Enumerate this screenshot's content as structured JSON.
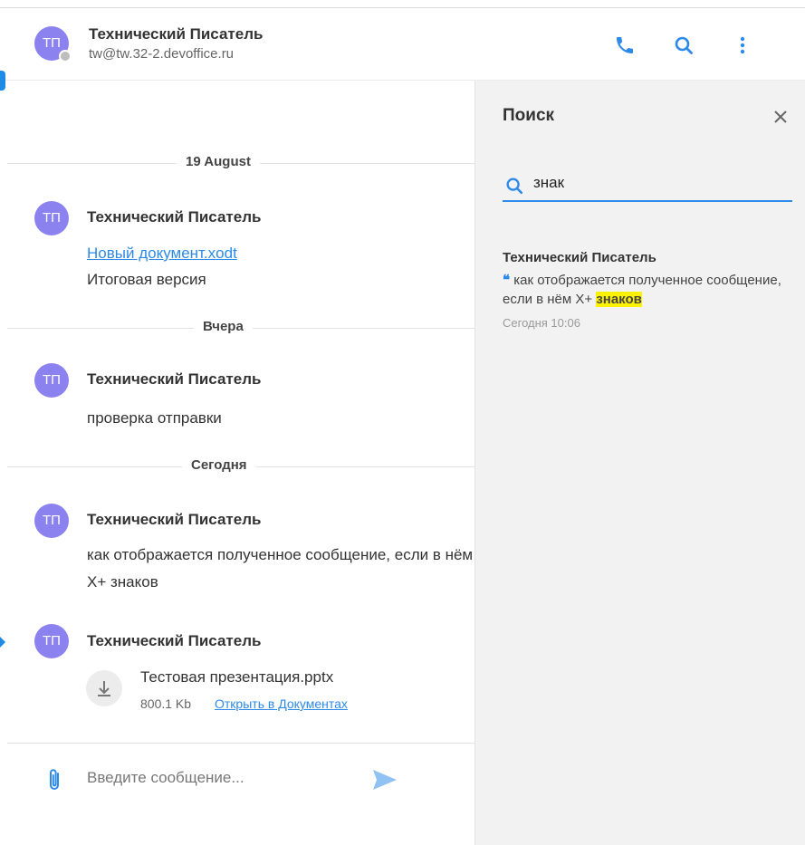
{
  "header": {
    "avatar_initials": "ТП",
    "contact_name": "Технический Писатель",
    "contact_email": "tw@tw.32-2.devoffice.ru",
    "icons": [
      "phone-icon",
      "search-icon",
      "more-vertical-icon"
    ]
  },
  "chat": {
    "days": [
      "19 August",
      "Вчера",
      "Сегодня"
    ],
    "messages": [
      {
        "avatar": "ТП",
        "author": "Технический Писатель",
        "link": "Новый документ.xodt",
        "text": "Итоговая версия"
      },
      {
        "avatar": "ТП",
        "author": "Технический Писатель",
        "text": "проверка отправки"
      },
      {
        "avatar": "ТП",
        "author": "Технический Писатель",
        "text_line1": "как отображается полученное сообщение, если в нём",
        "text_line2": "X+ знаков"
      },
      {
        "avatar": "ТП",
        "author": "Технический Писатель",
        "file_name": "Тестовая презентация.pptx",
        "file_size": "800.1 Kb",
        "file_open": "Открыть в Документах"
      }
    ]
  },
  "composer": {
    "placeholder": "Введите сообщение...",
    "icons": [
      "paperclip-icon",
      "send-icon"
    ]
  },
  "search_panel": {
    "title": "Поиск",
    "query": "знак",
    "result": {
      "author": "Технический Писатель",
      "quote_mark": "❝",
      "text_before": "как отображается полученное сообщение, если в нём X+ ",
      "highlight": "знаков",
      "time": "Сегодня 10:06"
    }
  },
  "colors": {
    "avatar": "#8c82ef",
    "accent": "#2d8ae8",
    "highlight": "#fff200",
    "panel_bg": "#f2f2f2"
  }
}
